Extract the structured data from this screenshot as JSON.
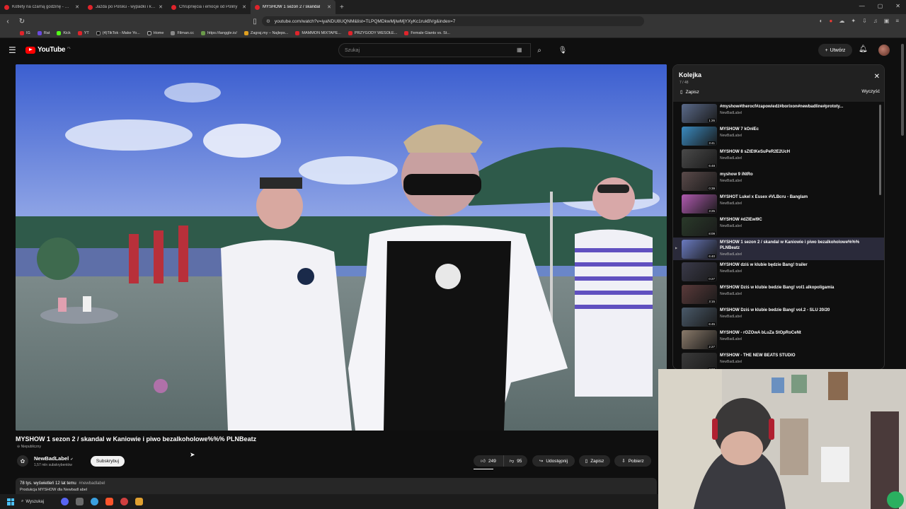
{
  "browser": {
    "tabs": [
      {
        "title": "Kotlety na czarną godzinę - mogą u"
      },
      {
        "title": "Jazda po Polsku - wypadki i kolizje"
      },
      {
        "title": "Chrupnięcia i emocje od Poliny"
      },
      {
        "title": "MYSHOW 1 sezon 2 / skandal",
        "active": true
      }
    ],
    "new_tab": "+",
    "url": "youtube.com/watch?v=iyaNDU8UQNM&list=TLPQMDkwMjIwMjYXyKc1rukBVg&index=7",
    "bookmarks": [
      "IG",
      "Rat",
      "Kick",
      "YT",
      "(4)TikTok - Make Yo...",
      "Home",
      "Filman.cc",
      "https://tanggle.io/",
      "Zagraj.my – Najleps...",
      "MAMMON MIXTAPE...",
      "PRZYGODY WESOŁE...",
      "Female Giants vs. St..."
    ]
  },
  "header": {
    "logo_text": "YouTube",
    "logo_country": "PL",
    "search_placeholder": "Szukaj",
    "create_label": "Utwórz"
  },
  "video": {
    "title": "MYSHOW 1 sezon 2 / skandal w Kaniowie i piwo bezalkoholowe%%% PLNBeatz",
    "badge": "Niepubliczny",
    "channel_name": "NewBadLabel",
    "channel_subs": "1,57 mln subskrybentów",
    "subscribe_label": "Subskrybuj",
    "likes": "249",
    "dislikes": "95",
    "share_label": "Udostępnij",
    "save_label": "Zapisz",
    "download_label": "Pobierz",
    "views": "78 tys. wyświetleń",
    "age": "12 lat temu",
    "hashtag": "#newbadlabel",
    "description": "Produkcja MYSHOW dla Newbadl abel"
  },
  "playlist": {
    "title": "Kolejka",
    "position": "7 / 48",
    "save_label": "Zapisz",
    "clear_label": "Wyczyść",
    "items": [
      {
        "title": "#myshow#therocf#zapowiedź#borixon#newbadline#prototy...",
        "channel": "NewBadLabel",
        "duration": "1:26",
        "color": "#5a6a8a"
      },
      {
        "title": "MYSHOW 7 kOnIEc",
        "channel": "NewBadLabel",
        "duration": "3:41",
        "color": "#3a8ac0"
      },
      {
        "title": "MYSHOW 8 sZtEtKeSuPeR2E2UcH",
        "channel": "NewBadLabel",
        "duration": "6:48",
        "color": "#4a4a4a"
      },
      {
        "title": "myshow 9 iNtRo",
        "channel": "NewBadLabel",
        "duration": "0:39",
        "color": "#5a4a4a"
      },
      {
        "title": "MYSHOT Lukel x Essex #VLBcru - Banglam",
        "channel": "NewBadLabel",
        "duration": "3:25",
        "color": "#b05ab0"
      },
      {
        "title": "MYSHOW #dZIEwI9Ć",
        "channel": "NewBadLabel",
        "duration": "8:09",
        "color": "#2a3a2a"
      },
      {
        "title": "MYSHOW 1 sezon 2 / skandal w Kaniowie i piwo bezalkoholowe%%% PLNBeatz",
        "channel": "NewBadLabel",
        "duration": "6:40",
        "color": "#6a7ac0",
        "active": true
      },
      {
        "title": "MYSHOW dziś w klubie będzie Bang! trailer",
        "channel": "NewBadLabel",
        "duration": "0:27",
        "color": "#3a3a4a"
      },
      {
        "title": "MYSHOW Dziś w klubie bedzie Bang! vol1 alkopoligamia",
        "channel": "NewBadLabel",
        "duration": "3:15",
        "color": "#5a3a3a"
      },
      {
        "title": "MYSHOW Dziś w klubie bedzie Bang! vol.2 - SLU 20/20",
        "channel": "NewBadLabel",
        "duration": "6:45",
        "color": "#4a5a6a"
      },
      {
        "title": "MYSHOW - rÓŻOwA bLuZa StOpRoCeNt",
        "channel": "NewBadLabel",
        "duration": "2:27",
        "color": "#8a7a6a"
      },
      {
        "title": "MYSHOW - THE NEW BEATS STUDIO",
        "channel": "NewBadLabel",
        "duration": "2:23",
        "color": "#3a3a3a"
      }
    ]
  },
  "taskbar": {
    "search_label": "Wyszukaj"
  }
}
